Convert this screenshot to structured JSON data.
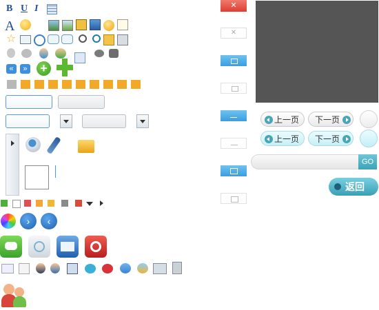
{
  "formatting": {
    "bold": "B",
    "underline": "U",
    "italic": "I",
    "font": "A"
  },
  "pager": {
    "prev_label": "上一页",
    "next_label": "下一页",
    "go_label": "GO",
    "back_label": "返回"
  },
  "colors": {
    "close_red": "#e8503f",
    "panel_dark": "#555555",
    "teal_accent": "#4aa5b8",
    "blue_tab": "#5ab6e8",
    "plus_green": "#5cb82e"
  },
  "icons": {
    "row_format": [
      "bold-icon",
      "underline-icon",
      "italic-icon",
      "table-icon"
    ],
    "row_media": [
      "font-icon",
      "smiley-icon",
      "image-icon",
      "insert-image-icon",
      "flash-icon",
      "screen-icon",
      "emoticon-icon",
      "note-icon"
    ],
    "row_misc": [
      "star-icon",
      "mail-icon",
      "search-icon",
      "chat-icon",
      "chat-reply-icon",
      "magnifier-icon",
      "magnifier-small-icon",
      "contact-card-icon",
      "remove-card-icon"
    ],
    "row_users": [
      "user-grey-icon",
      "users-grey-icon",
      "user-icon",
      "users-icon",
      "user-group-icon",
      "group-icon",
      "contact-icon"
    ],
    "apps": [
      "chat-app-icon",
      "wifi-app-icon",
      "mail-app-icon",
      "power-app-icon"
    ]
  }
}
